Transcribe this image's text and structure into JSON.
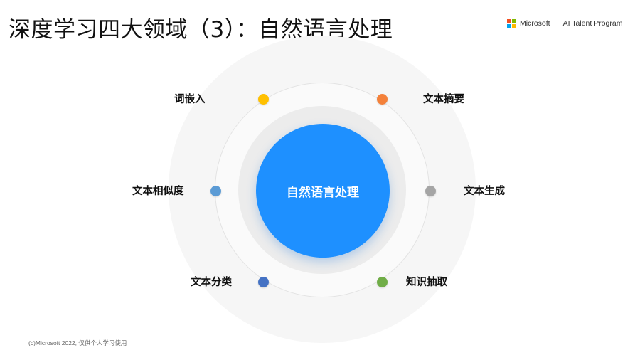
{
  "title": "深度学习四大领域（3）：自然语言处理",
  "brand": {
    "company": "Microsoft",
    "program": "AI Talent Program",
    "logo_colors": [
      "#f25022",
      "#7fba00",
      "#00a4ef",
      "#ffb900"
    ]
  },
  "diagram": {
    "center_label": "自然语言处理",
    "center_color": "#1e90ff",
    "nodes": [
      {
        "label": "词嵌入",
        "color": "#ffc000"
      },
      {
        "label": "文本摘要",
        "color": "#f4813a"
      },
      {
        "label": "文本相似度",
        "color": "#5b9bd5"
      },
      {
        "label": "文本生成",
        "color": "#a5a5a5"
      },
      {
        "label": "文本分类",
        "color": "#4472c4"
      },
      {
        "label": "知识抽取",
        "color": "#70ad47"
      }
    ]
  },
  "footer": "(c)Microsoft 2022, 仅供个人学习使用"
}
